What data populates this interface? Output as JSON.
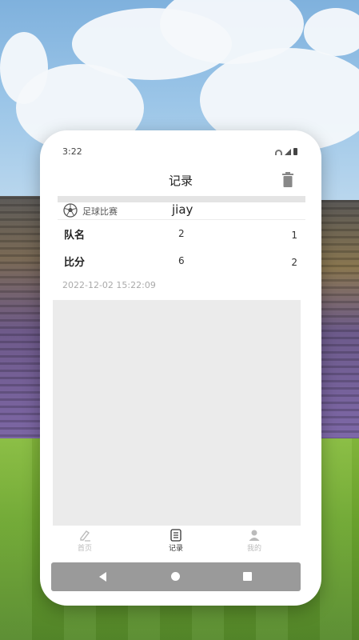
{
  "statusbar": {
    "time": "3:22"
  },
  "header": {
    "title": "记录"
  },
  "record": {
    "game_type": "足球比赛",
    "player": "jiay",
    "rows": [
      {
        "label": "队名",
        "value1": "2",
        "value2": "1"
      },
      {
        "label": "比分",
        "value1": "6",
        "value2": "2"
      }
    ],
    "timestamp": "2022-12-02 15:22:09"
  },
  "tabs": [
    {
      "label": "首页",
      "icon": "edit-icon",
      "active": false
    },
    {
      "label": "记录",
      "icon": "list-icon",
      "active": true
    },
    {
      "label": "我的",
      "icon": "user-icon",
      "active": false
    }
  ],
  "colors": {
    "accent": "#333333",
    "inactive_tab": "#bbbbbb",
    "navbar": "#9a9a9a",
    "content_bg": "#ebebeb"
  }
}
